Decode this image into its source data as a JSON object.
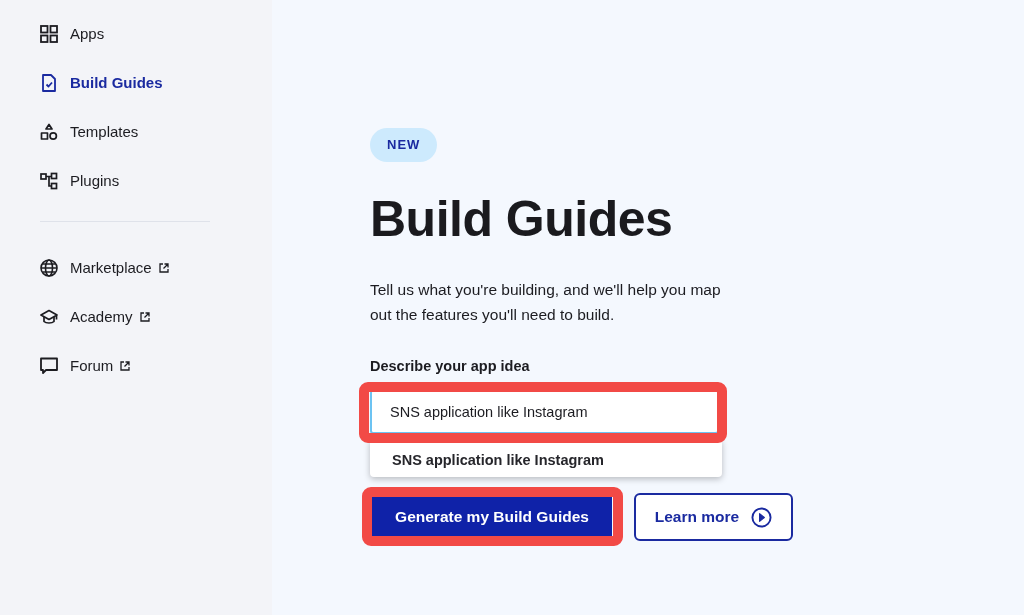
{
  "sidebar": {
    "items": [
      {
        "label": "Apps",
        "selected": false,
        "external": false
      },
      {
        "label": "Build Guides",
        "selected": true,
        "external": false
      },
      {
        "label": "Templates",
        "selected": false,
        "external": false
      },
      {
        "label": "Plugins",
        "selected": false,
        "external": false
      }
    ],
    "secondary_items": [
      {
        "label": "Marketplace",
        "selected": false,
        "external": true
      },
      {
        "label": "Academy",
        "selected": false,
        "external": true
      },
      {
        "label": "Forum",
        "selected": false,
        "external": true
      }
    ]
  },
  "main": {
    "badge": "NEW",
    "title": "Build Guides",
    "description": "Tell us what you're building, and we'll help you map out the features you'll need to build.",
    "idea_field": {
      "label": "Describe your app idea",
      "value": "SNS application like Instagram",
      "focused": true,
      "highlighted": true
    },
    "suggestions": [
      {
        "label": "SNS application like Instagram",
        "selected": false
      }
    ],
    "buttons": [
      {
        "label": "Generate my Build Guides",
        "kind": "primary",
        "highlighted": true
      },
      {
        "label": "Learn more",
        "kind": "secondary",
        "highlighted": false
      }
    ]
  }
}
